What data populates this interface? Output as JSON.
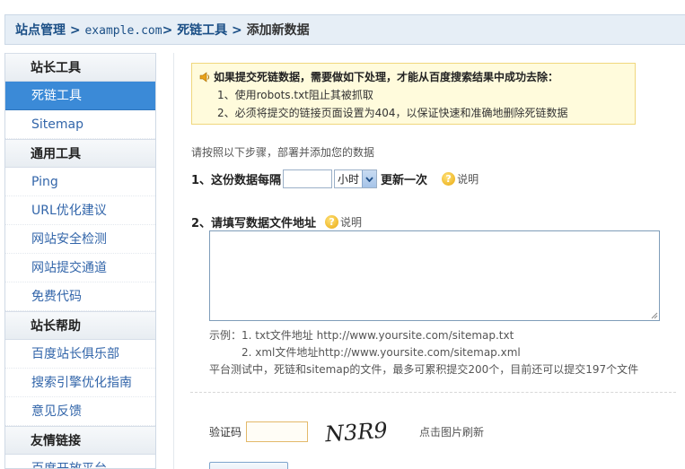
{
  "breadcrumb": {
    "site_manage": "站点管理",
    "sep1": " > ",
    "domain": "example.com",
    "sep2": "> ",
    "tool": "死链工具",
    "sep3": " > ",
    "current": "添加新数据"
  },
  "sidebar": {
    "sections": [
      {
        "title": "站长工具",
        "items": [
          {
            "label": "死链工具",
            "active": true
          },
          {
            "label": "Sitemap"
          }
        ]
      },
      {
        "title": "通用工具",
        "items": [
          {
            "label": "Ping"
          },
          {
            "label": "URL优化建议"
          },
          {
            "label": "网站安全检测"
          },
          {
            "label": "网站提交通道"
          },
          {
            "label": "免费代码"
          }
        ]
      },
      {
        "title": "站长帮助",
        "items": [
          {
            "label": "百度站长俱乐部"
          },
          {
            "label": "搜索引擎优化指南"
          },
          {
            "label": "意见反馈"
          }
        ]
      },
      {
        "title": "友情链接",
        "items": [
          {
            "label": "百度开放平台"
          }
        ]
      }
    ]
  },
  "notice": {
    "title": "如果提交死链数据，需要做如下处理，才能从百度搜索结果中成功去除：",
    "line1": "1、使用robots.txt阻止其被抓取",
    "line2": "2、必须将提交的链接页面设置为404，以保证快速和准确地删除死链数据"
  },
  "intro": "请按照以下步骤，部署并添加您的数据",
  "step1": {
    "label": "1、这份数据每隔",
    "value": "",
    "unit": "小时",
    "after": "更新一次",
    "help": "说明"
  },
  "step2": {
    "label": "2、请填写数据文件地址",
    "help": "说明",
    "value": ""
  },
  "examples": {
    "line1": "示例：1. txt文件地址 http://www.yoursite.com/sitemap.txt",
    "line2": "2. xml文件地址http://www.yoursite.com/sitemap.xml",
    "line3": "平台测试中，死链和sitemap的文件，最多可累积提交200个，目前还可以提交197个文件"
  },
  "captcha": {
    "label": "验证码",
    "value": "",
    "image_text": "N3R9",
    "refresh": "点击图片刷新"
  },
  "colors": {
    "active_item": "#3b8ad7",
    "link": "#3366aa",
    "notice_bg": "#fffbdc"
  }
}
